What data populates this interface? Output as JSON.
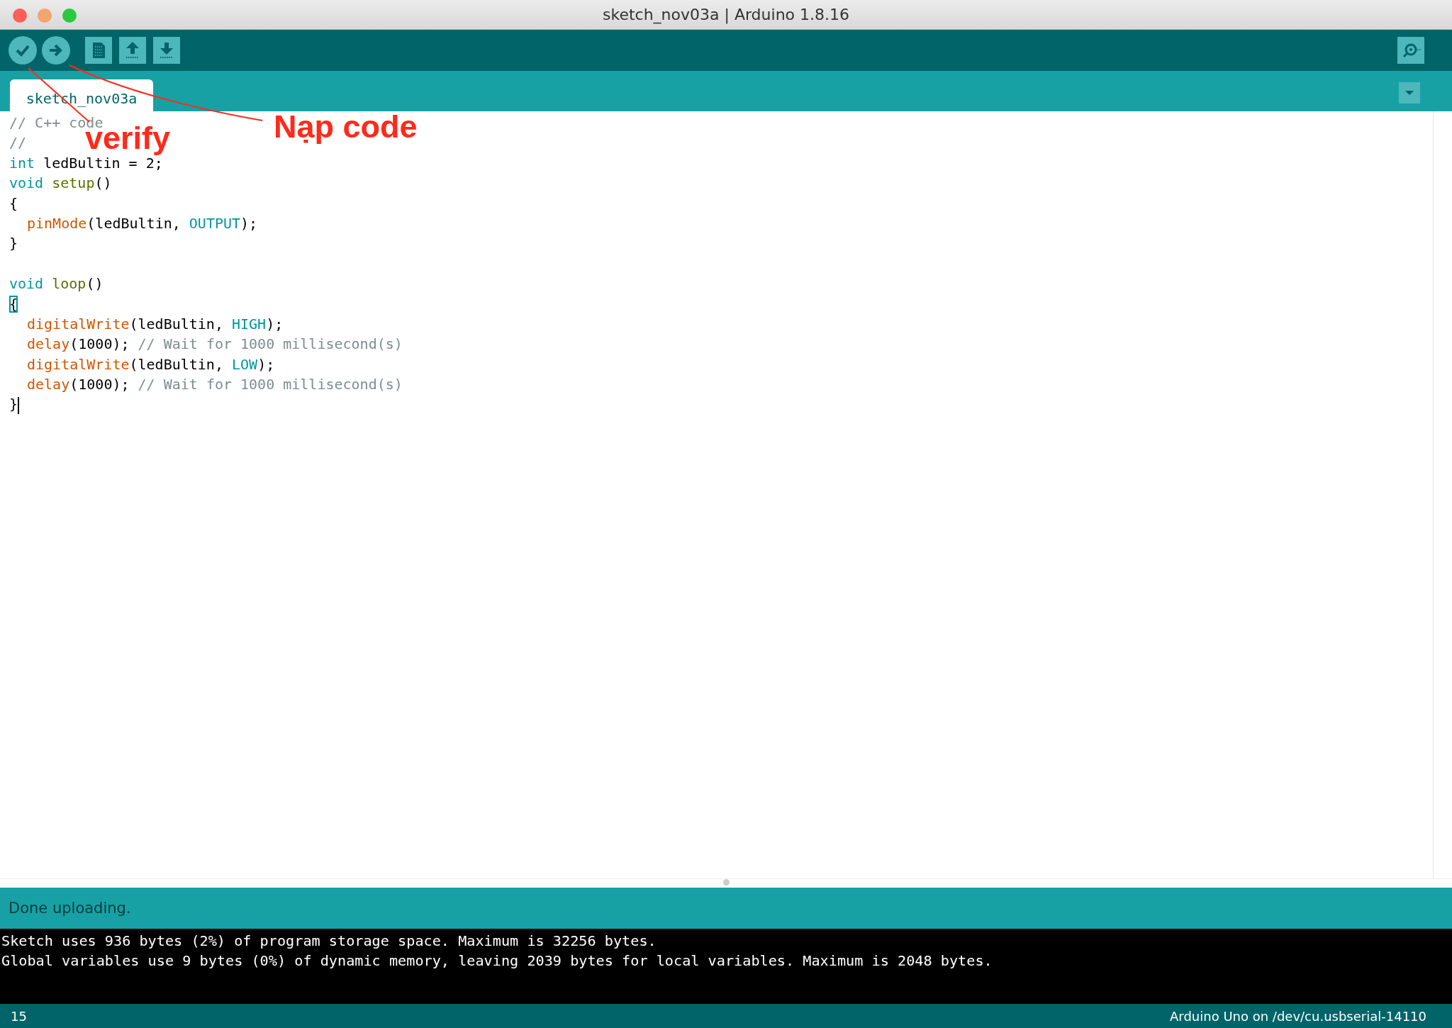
{
  "window": {
    "title": "sketch_nov03a | Arduino 1.8.16"
  },
  "toolbar": {
    "buttons": [
      {
        "kind": "verify"
      },
      {
        "kind": "upload"
      },
      {
        "kind": "new"
      },
      {
        "kind": "open"
      },
      {
        "kind": "save"
      }
    ],
    "right_buttons": [
      {
        "kind": "serial-monitor"
      }
    ]
  },
  "tabs": [
    {
      "label": "sketch_nov03a",
      "selected": true
    }
  ],
  "editor": {
    "lines": [
      {
        "tokens": [
          {
            "text": "// C++ code",
            "kind": "comment"
          }
        ]
      },
      {
        "tokens": [
          {
            "text": "//",
            "kind": "comment"
          }
        ]
      },
      {
        "tokens": [
          {
            "text": "int",
            "kind": "keyword"
          },
          {
            "text": " ledBultin = 2;",
            "kind": "plain"
          }
        ]
      },
      {
        "tokens": [
          {
            "text": "void",
            "kind": "keyword"
          },
          {
            "text": " setup",
            "kind": "builtin"
          },
          {
            "text": "()",
            "kind": "plain"
          }
        ]
      },
      {
        "tokens": [
          {
            "text": "{",
            "kind": "plain"
          }
        ]
      },
      {
        "indented": true,
        "tokens": [
          {
            "text": "pinMode",
            "kind": "function"
          },
          {
            "text": "(ledBultin, ",
            "kind": "plain"
          },
          {
            "text": "OUTPUT",
            "kind": "constant"
          },
          {
            "text": ");",
            "kind": "plain"
          }
        ]
      },
      {
        "tokens": [
          {
            "text": "}",
            "kind": "plain"
          }
        ]
      },
      {
        "blank_before": true,
        "tokens": [
          {
            "text": "void",
            "kind": "keyword"
          },
          {
            "text": " loop",
            "kind": "builtin"
          },
          {
            "text": "()",
            "kind": "plain"
          }
        ]
      },
      {
        "tokens": [
          {
            "text": "{",
            "kind": "bracket"
          }
        ]
      },
      {
        "indented": true,
        "tokens": [
          {
            "text": "digitalWrite",
            "kind": "function"
          },
          {
            "text": "(ledBultin, ",
            "kind": "plain"
          },
          {
            "text": "HIGH",
            "kind": "constant"
          },
          {
            "text": ");",
            "kind": "plain"
          }
        ]
      },
      {
        "indented": true,
        "tokens": [
          {
            "text": "delay",
            "kind": "function"
          },
          {
            "text": "(1000); ",
            "kind": "plain"
          },
          {
            "text": "// Wait for 1000 millisecond(s)",
            "kind": "comment"
          }
        ]
      },
      {
        "indented": true,
        "tokens": [
          {
            "text": "digitalWrite",
            "kind": "function"
          },
          {
            "text": "(ledBultin, ",
            "kind": "plain"
          },
          {
            "text": "LOW",
            "kind": "constant"
          },
          {
            "text": ");",
            "kind": "plain"
          }
        ]
      },
      {
        "indented": true,
        "tokens": [
          {
            "text": "delay",
            "kind": "function"
          },
          {
            "text": "(1000); ",
            "kind": "plain"
          },
          {
            "text": "// Wait for 1000 millisecond(s)",
            "kind": "comment"
          }
        ]
      },
      {
        "cursor": true,
        "tokens": [
          {
            "text": "}",
            "kind": "plain"
          }
        ]
      }
    ]
  },
  "status_message": "Done uploading.",
  "console": [
    "Sketch uses 936 bytes (2%) of program storage space. Maximum is 32256 bytes.",
    "Global variables use 9 bytes (0%) of dynamic memory, leaving 2039 bytes for local variables. Maximum is 2048 bytes."
  ],
  "status_bar": {
    "line_number": "15",
    "board": "Arduino Uno on /dev/cu.usbserial-14110"
  },
  "annotations": [
    {
      "text": "verify"
    },
    {
      "text": "Nạp code"
    }
  ]
}
